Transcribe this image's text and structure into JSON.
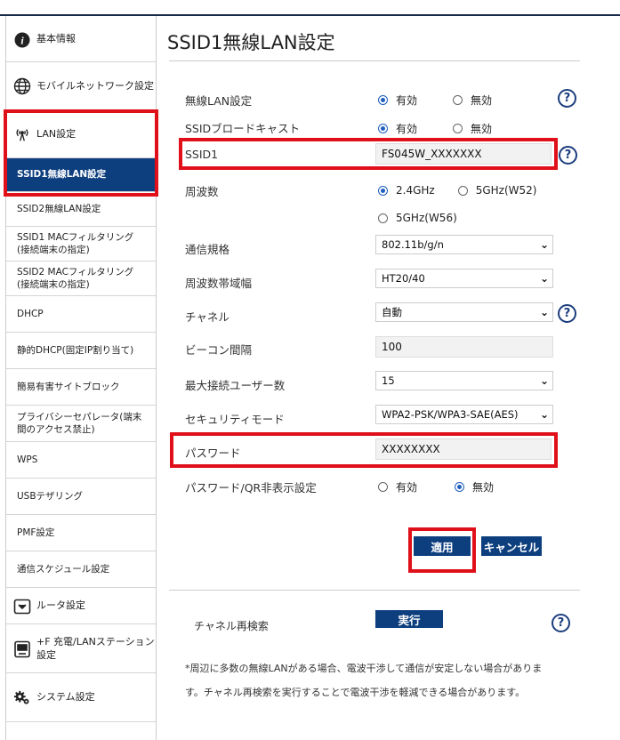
{
  "page_title": "SSID1無線LAN設定",
  "sidebar": {
    "items": [
      {
        "label": "基本情報",
        "icon": "info-icon"
      },
      {
        "label": "モバイルネットワーク設定",
        "icon": "globe-icon"
      },
      {
        "label": "LAN設定",
        "icon": "wireless-antenna-icon"
      },
      {
        "label": "SSID1無線LAN設定"
      },
      {
        "label": "SSID2無線LAN設定"
      },
      {
        "label": "SSID1 MACフィルタリング\n(接続端末の指定)"
      },
      {
        "label": "SSID2 MACフィルタリング\n(接続端末の指定)"
      },
      {
        "label": "DHCP"
      },
      {
        "label": "静的DHCP(固定IP割り当て)"
      },
      {
        "label": "簡易有害サイトブロック"
      },
      {
        "label": "プライバシーセパレータ(端末\n間のアクセス禁止)"
      },
      {
        "label": "WPS"
      },
      {
        "label": "USBテザリング"
      },
      {
        "label": "PMF設定"
      },
      {
        "label": "通信スケジュール設定"
      },
      {
        "label": "ルータ設定",
        "icon": "router-icon"
      },
      {
        "label": "+F 充電/LANステーション\n設定",
        "icon": "station-icon"
      },
      {
        "label": "システム設定",
        "icon": "gears-icon"
      }
    ]
  },
  "form": {
    "wireless_lan": {
      "label": "無線LAN設定",
      "opt_on": "有効",
      "opt_off": "無効",
      "selected": "on"
    },
    "ssid_broadcast": {
      "label": "SSIDブロードキャスト",
      "opt_on": "有効",
      "opt_off": "無効",
      "selected": "on"
    },
    "ssid1": {
      "label": "SSID1",
      "value": "FS045W_XXXXXXX"
    },
    "frequency": {
      "label": "周波数",
      "opt1": "2.4GHz",
      "opt2": "5GHz(W52)",
      "opt3": "5GHz(W56)",
      "selected": "2.4GHz"
    },
    "standard": {
      "label": "通信規格",
      "value": "802.11b/g/n"
    },
    "bandwidth": {
      "label": "周波数帯域幅",
      "value": "HT20/40"
    },
    "channel": {
      "label": "チャネル",
      "value": "自動"
    },
    "beacon": {
      "label": "ビーコン間隔",
      "value": "100"
    },
    "max_users": {
      "label": "最大接続ユーザー数",
      "value": "15"
    },
    "security": {
      "label": "セキュリティモード",
      "value": "WPA2-PSK/WPA3-SAE(AES)"
    },
    "password": {
      "label": "パスワード",
      "value": "XXXXXXXX"
    },
    "hide_pw": {
      "label": "パスワード/QR非表示設定",
      "opt_on": "有効",
      "opt_off": "無効",
      "selected": "off"
    }
  },
  "buttons": {
    "apply": "適用",
    "cancel": "キャンセル",
    "execute": "実行"
  },
  "channel_rescan": {
    "label": "チャネル再検索"
  },
  "note": "*周辺に多数の無線LANがある場合、電波干渉して通信が安定しない場合があります。チャネル再検索を実行することで電波干渉を軽減できる場合があります。",
  "help_symbol": "?",
  "colors": {
    "accent": "#0d3f7f",
    "highlight": "#e0101a",
    "radio": "#1f5fbf"
  }
}
